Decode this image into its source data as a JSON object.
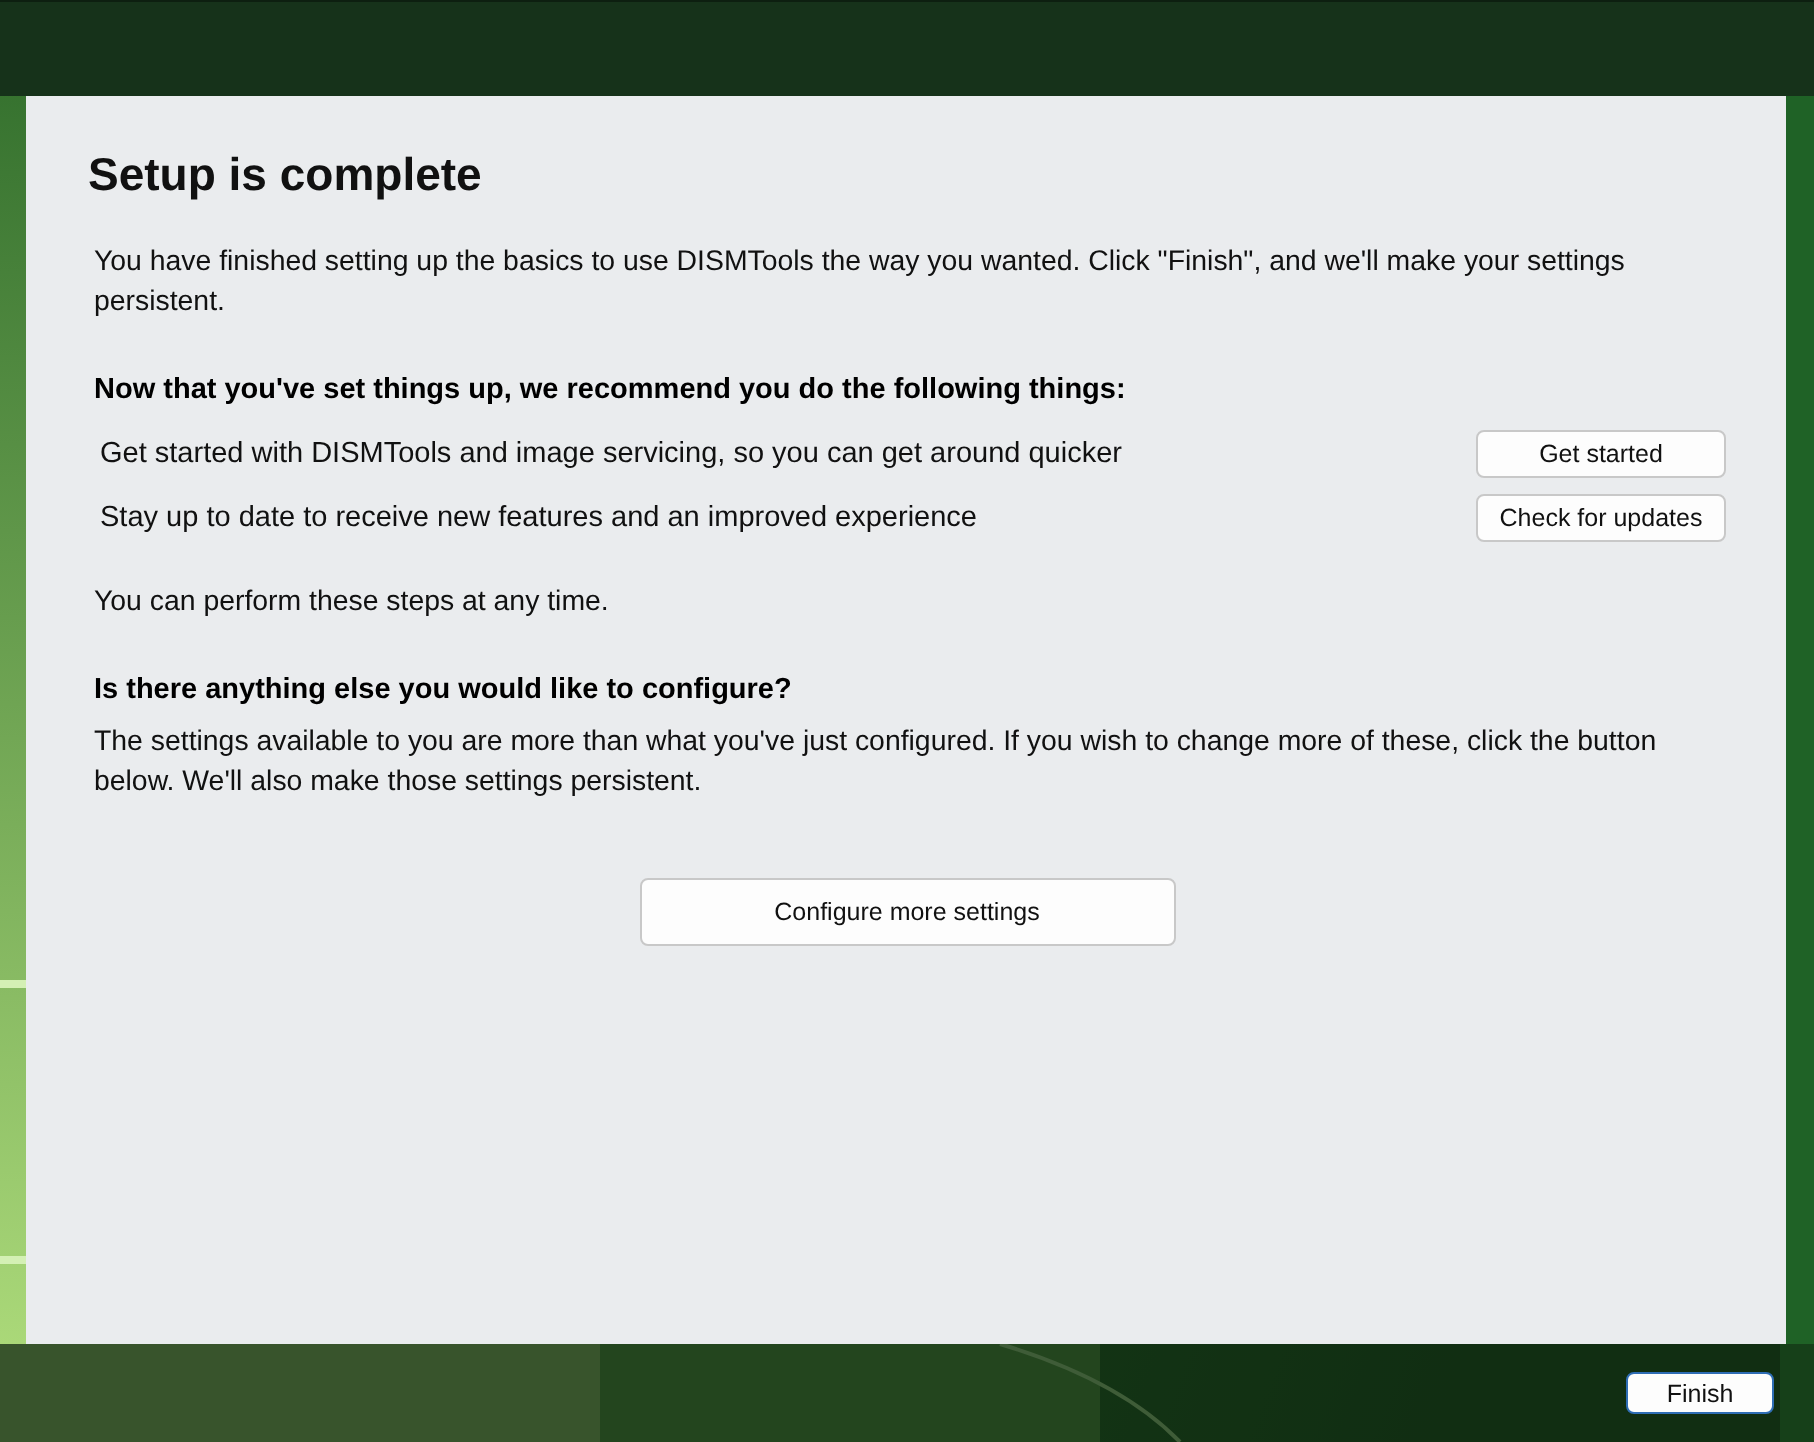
{
  "title": "Setup is complete",
  "intro": "You have finished setting up the basics to use DISMTools the way you wanted. Click \"Finish\", and we'll make your settings persistent.",
  "recommend_heading": "Now that you've set things up, we recommend you do the following things:",
  "recommendations": [
    {
      "text": "Get started with DISMTools and image servicing, so you can get around quicker",
      "button": "Get started"
    },
    {
      "text": "Stay up to date to receive new features and an improved experience",
      "button": "Check for updates"
    }
  ],
  "anytime_note": "You can perform these steps at any time.",
  "configure_heading": "Is there anything else you would like to configure?",
  "configure_text": "The settings available to you are more than what you've just configured. If you wish to change more of these, click the button below. We'll also make those settings persistent.",
  "configure_button": "Configure more settings",
  "finish_button": "Finish"
}
